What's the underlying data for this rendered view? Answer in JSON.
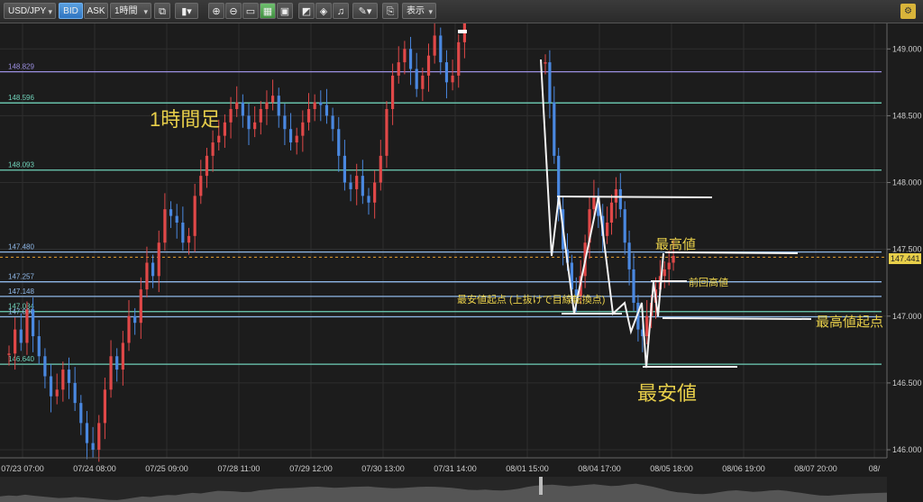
{
  "toolbar": {
    "symbol": "USD/JPY",
    "bid_label": "BID",
    "ask_label": "ASK",
    "timeframe": "1時間",
    "display_label": "表示"
  },
  "chart_data": {
    "type": "candlestick",
    "title": "1時間足",
    "ylim": [
      145.98,
      149.13
    ],
    "y_ticks": [
      "149.000",
      "148.500",
      "148.000",
      "147.500",
      "147.000",
      "146.500",
      "146.000"
    ],
    "x_ticks": [
      "07/23 07:00",
      "07/24 08:00",
      "07/25 09:00",
      "07/28 11:00",
      "07/29 12:00",
      "07/30 13:00",
      "07/31 14:00",
      "08/01 15:00",
      "08/04 17:00",
      "08/05 18:00",
      "08/06 19:00",
      "08/07 20:00",
      "08/"
    ],
    "current_price": "147.441",
    "colors": {
      "up": "#e04848",
      "down": "#4a88e0"
    },
    "levels": [
      {
        "label": "148.829",
        "value": 148.829,
        "color": "#9b8fe0"
      },
      {
        "label": "148.596",
        "value": 148.596,
        "color": "#6fd0b8"
      },
      {
        "label": "148.093",
        "value": 148.093,
        "color": "#6fd0b8"
      },
      {
        "label": "147.480",
        "value": 147.48,
        "color": "#8fb8e8"
      },
      {
        "label": "147.257",
        "value": 147.257,
        "color": "#8fb8e8"
      },
      {
        "label": "147.148",
        "value": 147.148,
        "color": "#8fb8e8"
      },
      {
        "label": "147.034",
        "value": 147.034,
        "color": "#6fd0b8"
      },
      {
        "label": "147.000",
        "value": 146.995,
        "color": "#8fb8e8"
      },
      {
        "label": "146.640",
        "value": 146.64,
        "color": "#6fd0b8"
      }
    ],
    "annotations": {
      "high": "最高値",
      "prev_high": "前回高値",
      "low_origin": "最安値起点 (上抜けで目線転換点)",
      "high_origin": "最高値起点",
      "low": "最安値"
    },
    "segments": [
      {
        "closes": [
          146.72,
          146.9,
          146.8,
          147.05,
          146.85,
          146.7,
          146.55,
          146.4,
          146.45,
          146.6,
          146.5,
          146.35,
          146.2,
          146.05,
          146.0,
          146.2,
          146.45,
          146.7,
          146.6,
          146.8,
          147.0,
          146.95,
          147.2,
          147.4,
          147.3,
          147.55,
          147.8,
          147.75,
          147.7,
          147.55,
          147.6,
          147.9,
          148.05,
          148.2,
          148.3,
          148.35,
          148.45,
          148.55,
          148.6,
          148.5,
          148.4,
          148.45,
          148.55,
          148.6,
          148.65,
          148.5,
          148.4,
          148.3,
          148.35,
          148.45,
          148.55,
          148.6,
          148.58,
          148.5,
          148.4,
          148.2,
          148.0,
          147.95,
          148.05,
          147.9,
          147.85,
          148.0,
          148.2,
          148.55,
          148.8,
          148.9,
          149.0,
          148.85,
          148.7,
          148.8,
          148.95,
          149.1,
          148.9,
          148.75,
          148.8,
          149.05,
          149.2
        ]
      },
      {
        "closes": [
          148.9,
          148.6,
          148.2,
          147.8,
          147.5,
          147.4,
          147.2,
          147.15,
          147.3,
          147.55,
          147.8,
          147.9,
          147.75,
          147.6,
          147.7,
          147.85,
          147.95,
          147.8,
          147.55,
          147.35,
          147.1,
          146.9,
          146.85,
          147.0,
          147.1,
          147.2,
          147.3,
          147.35,
          147.4,
          147.45
        ]
      }
    ]
  }
}
